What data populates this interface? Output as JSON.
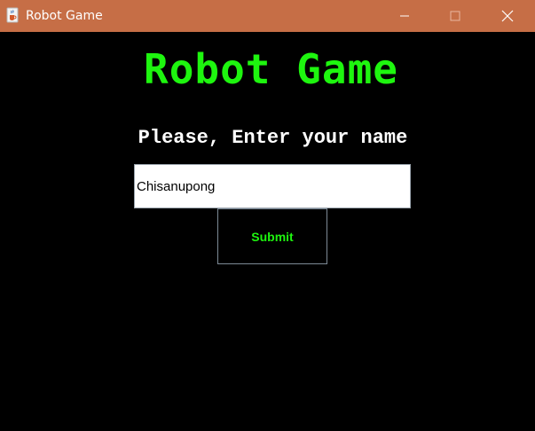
{
  "window": {
    "title": "Robot Game",
    "icon": "java-cup-icon",
    "titlebar_color": "#C66E46",
    "controls": {
      "minimize": "minimize-icon",
      "maximize": "maximize-icon",
      "close": "close-icon"
    }
  },
  "main": {
    "heading": "Robot Game",
    "prompt": "Please, Enter your name",
    "name_input": {
      "value": "Chisanupong",
      "placeholder": ""
    },
    "submit_label": "Submit"
  },
  "colors": {
    "background": "#000000",
    "accent_green": "#1EF50F",
    "prompt_text": "#FFFFFF"
  }
}
